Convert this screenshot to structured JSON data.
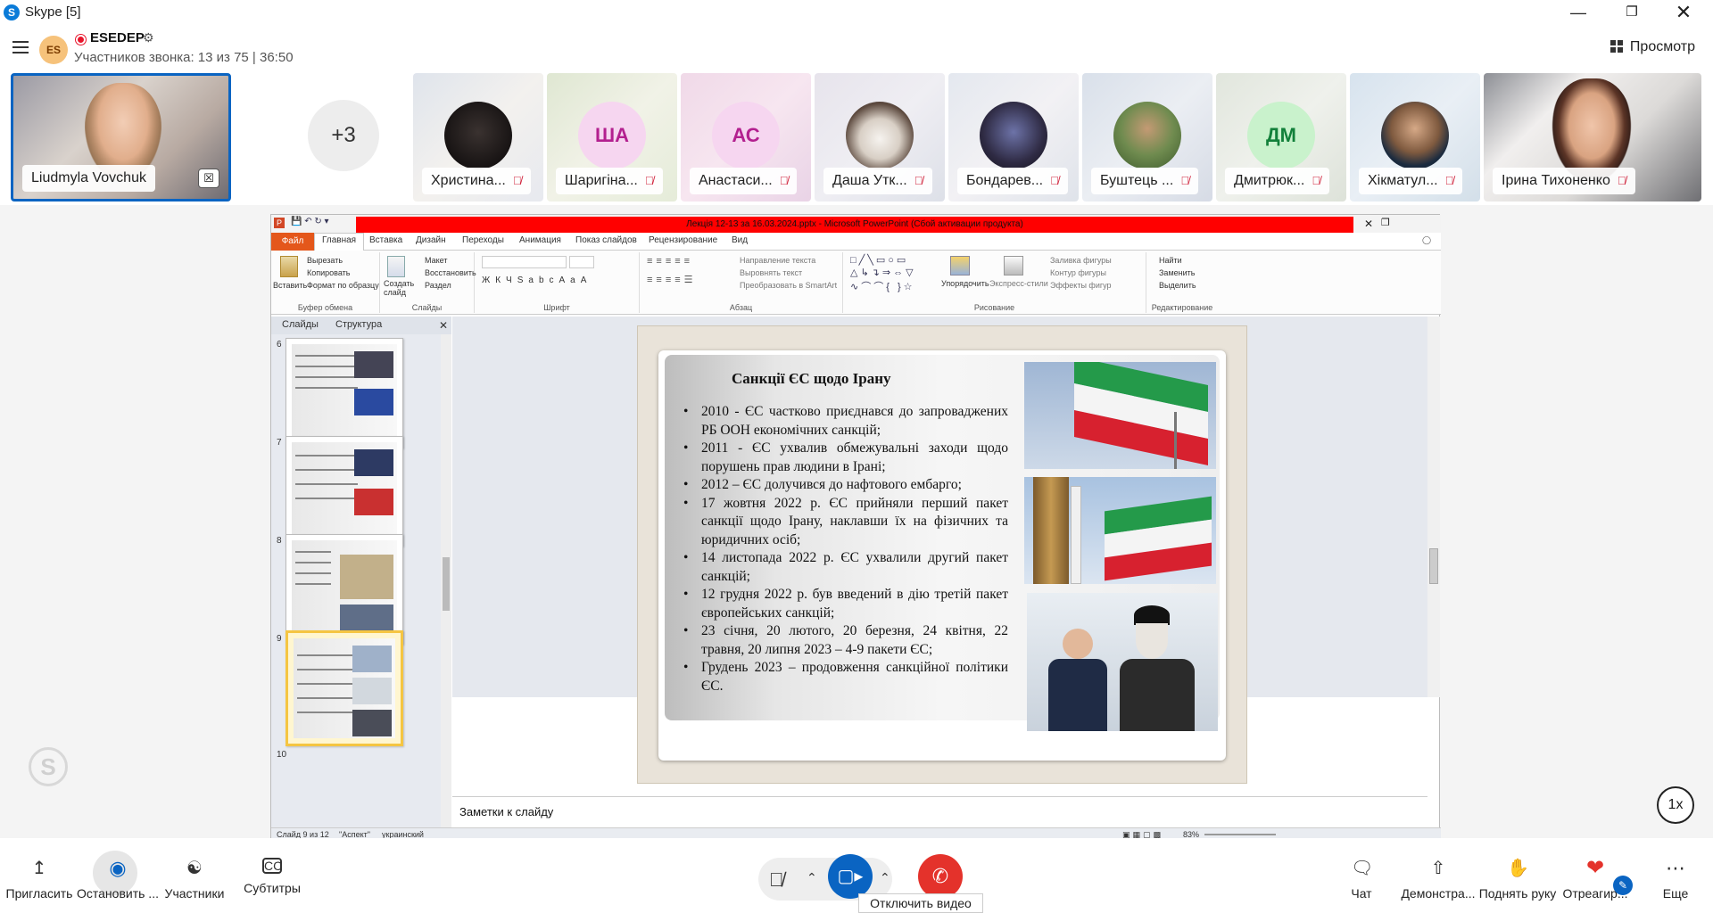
{
  "window": {
    "title": "Skype [5]"
  },
  "call": {
    "name": "ESEDEP",
    "avatar_initials": "ES",
    "subtitle": "Участников звонка: 13 из 75 | 36:50",
    "preview_label": "Просмотр"
  },
  "participants": [
    {
      "name": "Liudmyla Vovchuk",
      "type": "self"
    },
    {
      "name": "+3",
      "type": "more"
    },
    {
      "name": "Христина...",
      "type": "photo",
      "muted": true
    },
    {
      "name": "Шаригіна...",
      "initials": "ША",
      "type": "initials",
      "muted": true
    },
    {
      "name": "Анастаси...",
      "initials": "АС",
      "type": "initials",
      "muted": true
    },
    {
      "name": "Даша Утк...",
      "type": "photo",
      "muted": true
    },
    {
      "name": "Бондарев...",
      "type": "photo",
      "muted": true
    },
    {
      "name": "Буштець ...",
      "type": "photo",
      "muted": true
    },
    {
      "name": "Дмитрюк...",
      "initials": "ДМ",
      "type": "initials",
      "muted": true
    },
    {
      "name": "Хікматул...",
      "type": "photo",
      "muted": true
    },
    {
      "name": "Ірина Тихоненко",
      "type": "photo",
      "muted": true
    }
  ],
  "ppt": {
    "titlebar": "Лекція 12-13 за 16.03.2024.pptx - Microsoft PowerPoint (Сбой активации продукта)",
    "tabs": [
      "Файл",
      "Главная",
      "Вставка",
      "Дизайн",
      "Переходы",
      "Анимация",
      "Показ слайдов",
      "Рецензирование",
      "Вид"
    ],
    "ribbon": {
      "clipboard": {
        "paste": "Вставить",
        "cut": "Вырезать",
        "copy": "Копировать",
        "format": "Формат по образцу",
        "label": "Буфер обмена"
      },
      "slides": {
        "new": "Создать слайд",
        "layout": "Макет",
        "reset": "Восстановить",
        "section": "Раздел",
        "label": "Слайды"
      },
      "font": {
        "label": "Шрифт"
      },
      "paragraph": {
        "direction": "Направление текста",
        "align": "Выровнять текст",
        "smartart": "Преобразовать в SmartArt",
        "label": "Абзац"
      },
      "drawing": {
        "arrange": "Упорядочить",
        "styles": "Экспресс-стили",
        "fill": "Заливка фигуры",
        "outline": "Контур фигуры",
        "effects": "Эффекты фигур",
        "label": "Рисование"
      },
      "editing": {
        "find": "Найти",
        "replace": "Заменить",
        "select": "Выделить",
        "label": "Редактирование"
      }
    },
    "pane_tabs": [
      "Слайды",
      "Структура"
    ],
    "thumb_numbers": [
      "6",
      "7",
      "8",
      "9",
      "10"
    ],
    "slide": {
      "title": "Санкції ЄС щодо Ірану",
      "bullets": [
        "2010 - ЄС частково приєднався до запроваджених РБ ООН економічних санкцій;",
        "2011 - ЄС ухвалив обмежувальні заходи щодо порушень прав людини в Ірані;",
        "2012 – ЄС долучився до нафтового ембарго;",
        "17 жовтня 2022 р. ЄС прийняли перший пакет санкції щодо Ірану, наклавши їх на фізичних та юридичних осіб;",
        "14 листопада 2022 р. ЄС ухвалили другий пакет санкцій;",
        "12 грудня 2022 р. був введений в дію третій пакет європейських санкцій;",
        "23 січня, 20 лютого, 20 березня, 24 квітня, 22 травня, 20 липня 2023 – 4-9 пакети ЄС;",
        "Грудень 2023 – продовження санкційної політики ЄС."
      ]
    },
    "notes_placeholder": "Заметки к слайду",
    "status": {
      "slide": "Слайд 9 из 12",
      "theme": "\"Аспект\"",
      "lang": "украинский",
      "zoom": "83%"
    }
  },
  "speed": "1x",
  "bottom": {
    "invite": "Пригласить",
    "stop": "Остановить ...",
    "participants": "Участники",
    "subtitles": "Субтитры",
    "chat": "Чат",
    "present": "Демонстра...",
    "raise": "Поднять руку",
    "react": "Отреагир...",
    "more": "Еще",
    "tooltip": "Отключить видео"
  },
  "colors": {
    "accent": "#0a64c2",
    "hangup": "#e4322b",
    "ppt_red": "#ff0000",
    "file_tab": "#e4571b"
  }
}
